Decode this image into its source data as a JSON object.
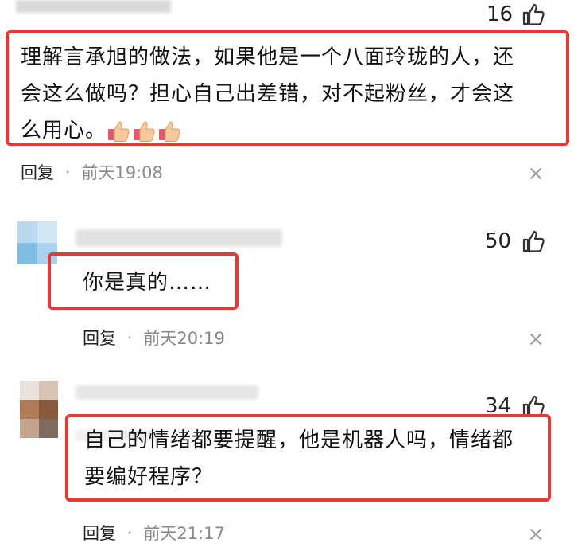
{
  "comments": [
    {
      "likes": "16",
      "text_lines": [
        "理解言承旭的做法，如果他是一个八面玲珑的人，还",
        "会这么做吗？担心自己出差错，对不起粉丝，才会这",
        "么用心。"
      ],
      "emojis": [
        "thumbs-up-emoji",
        "thumbs-up-emoji",
        "thumbs-up-emoji"
      ],
      "reply_label": "回复",
      "separator": "·",
      "time": "前天19:08"
    },
    {
      "likes": "50",
      "text": "你是真的……",
      "reply_label": "回复",
      "separator": "·",
      "time": "前天20:19"
    },
    {
      "likes": "34",
      "text_lines": [
        "自己的情绪都要提醒，他是机器人吗，情绪都",
        "要编好程序？"
      ],
      "reply_label": "回复",
      "separator": "·",
      "time": "前天21:17"
    }
  ],
  "colors": {
    "highlight_border": "#e53935",
    "meta_gray": "#8a8a8a",
    "divider": "#eeeeee"
  }
}
